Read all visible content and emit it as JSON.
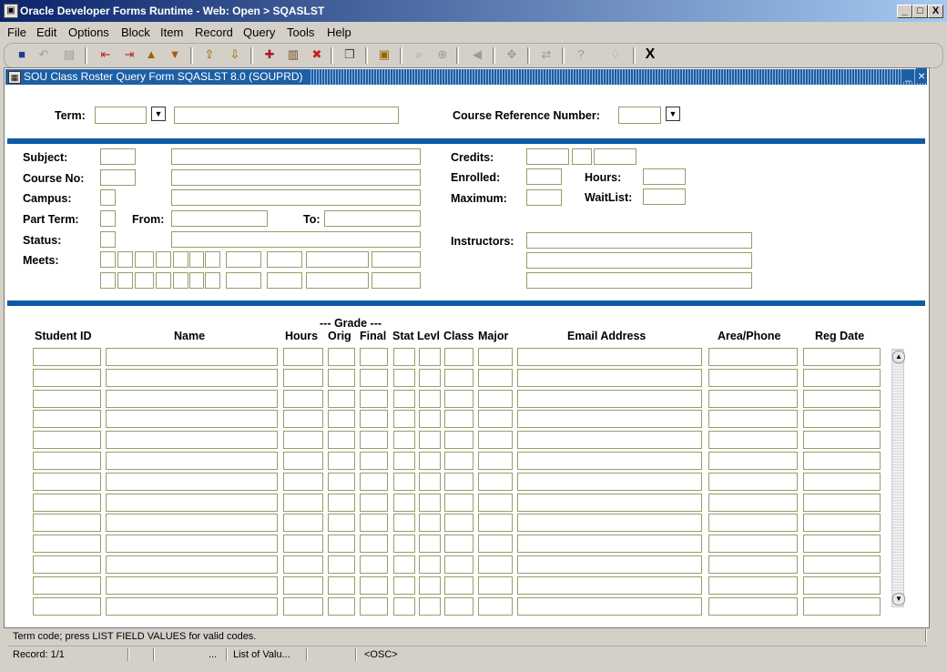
{
  "window": {
    "title": "Oracle Developer Forms Runtime - Web:  Open > SQASLST",
    "app_icon": "oracle-app-icon"
  },
  "window_controls": {
    "minimize": "_",
    "maximize": "□",
    "close": "X"
  },
  "menu": [
    "File",
    "Edit",
    "Options",
    "Block",
    "Item",
    "Record",
    "Query",
    "Tools",
    "Help"
  ],
  "toolbar": {
    "exit_label": "X"
  },
  "form": {
    "title": "SOU Class Roster Query Form  SQASLST  8.0  (SOUPRD)",
    "min_label": "_",
    "close_label": "×"
  },
  "key_block": {
    "term_label": "Term:",
    "term_value": "",
    "term_desc": "",
    "crn_label": "Course Reference Number:",
    "crn_value": ""
  },
  "course": {
    "subject_label": "Subject:",
    "course_no_label": "Course No:",
    "campus_label": "Campus:",
    "part_term_label": "Part Term:",
    "from_label": "From:",
    "to_label": "To:",
    "status_label": "Status:",
    "meets_label": "Meets:",
    "credits_label": "Credits:",
    "enrolled_label": "Enrolled:",
    "hours_label": "Hours:",
    "maximum_label": "Maximum:",
    "waitlist_label": "WaitList:",
    "instructors_label": "Instructors:"
  },
  "roster": {
    "grade_group": "--- Grade ---",
    "columns": [
      "Student ID",
      "Name",
      "Hours",
      "Orig",
      "Final",
      "Stat",
      "Levl",
      "Class",
      "Major",
      "Email Address",
      "Area/Phone",
      "Reg Date"
    ],
    "rows": 13
  },
  "status": {
    "message": "Term code; press LIST FIELD VALUES for valid codes.",
    "record": "Record: 1/1",
    "ellipsis": "...",
    "list_values": "List of Valu...",
    "osc": "<OSC>"
  },
  "colors": {
    "accent_bar": "#0d5aa7",
    "field_border": "#9b9b6b",
    "title_gradient_start": "#0a246a"
  }
}
